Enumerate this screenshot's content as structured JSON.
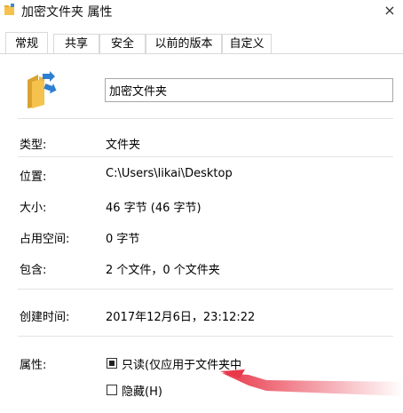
{
  "window": {
    "title": "加密文件夹 属性",
    "close_glyph": "×"
  },
  "tabs": [
    {
      "label": "常规",
      "active": true
    },
    {
      "label": "共享",
      "active": false
    },
    {
      "label": "安全",
      "active": false
    },
    {
      "label": "以前的版本",
      "active": false
    },
    {
      "label": "自定义",
      "active": false
    }
  ],
  "general": {
    "name_value": "加密文件夹",
    "type_label": "类型:",
    "type_value": "文件夹",
    "location_label": "位置:",
    "location_value": "C:\\Users\\likai\\Desktop",
    "size_label": "大小:",
    "size_value": "46 字节 (46 字节)",
    "disk_size_label": "占用空间:",
    "disk_size_value": "0 字节",
    "contains_label": "包含:",
    "contains_value": "2 个文件，0 个文件夹",
    "created_label": "创建时间:",
    "created_value": "2017年12月6日，23:12:22",
    "attributes_label": "属性:",
    "readonly_label": "只读(仅应用于文件夹中",
    "readonly_checked": true,
    "hidden_label": "隐藏(H)",
    "hidden_checked": false
  },
  "colors": {
    "folder_yellow": "#f5c34d",
    "folder_shadow": "#d9a22f",
    "accent_arrow": "#e8384a",
    "border": "#a8a8a8"
  },
  "icons": {
    "title": "folder-icon",
    "main": "folder-with-blue-arrows-icon",
    "close": "close-icon"
  }
}
